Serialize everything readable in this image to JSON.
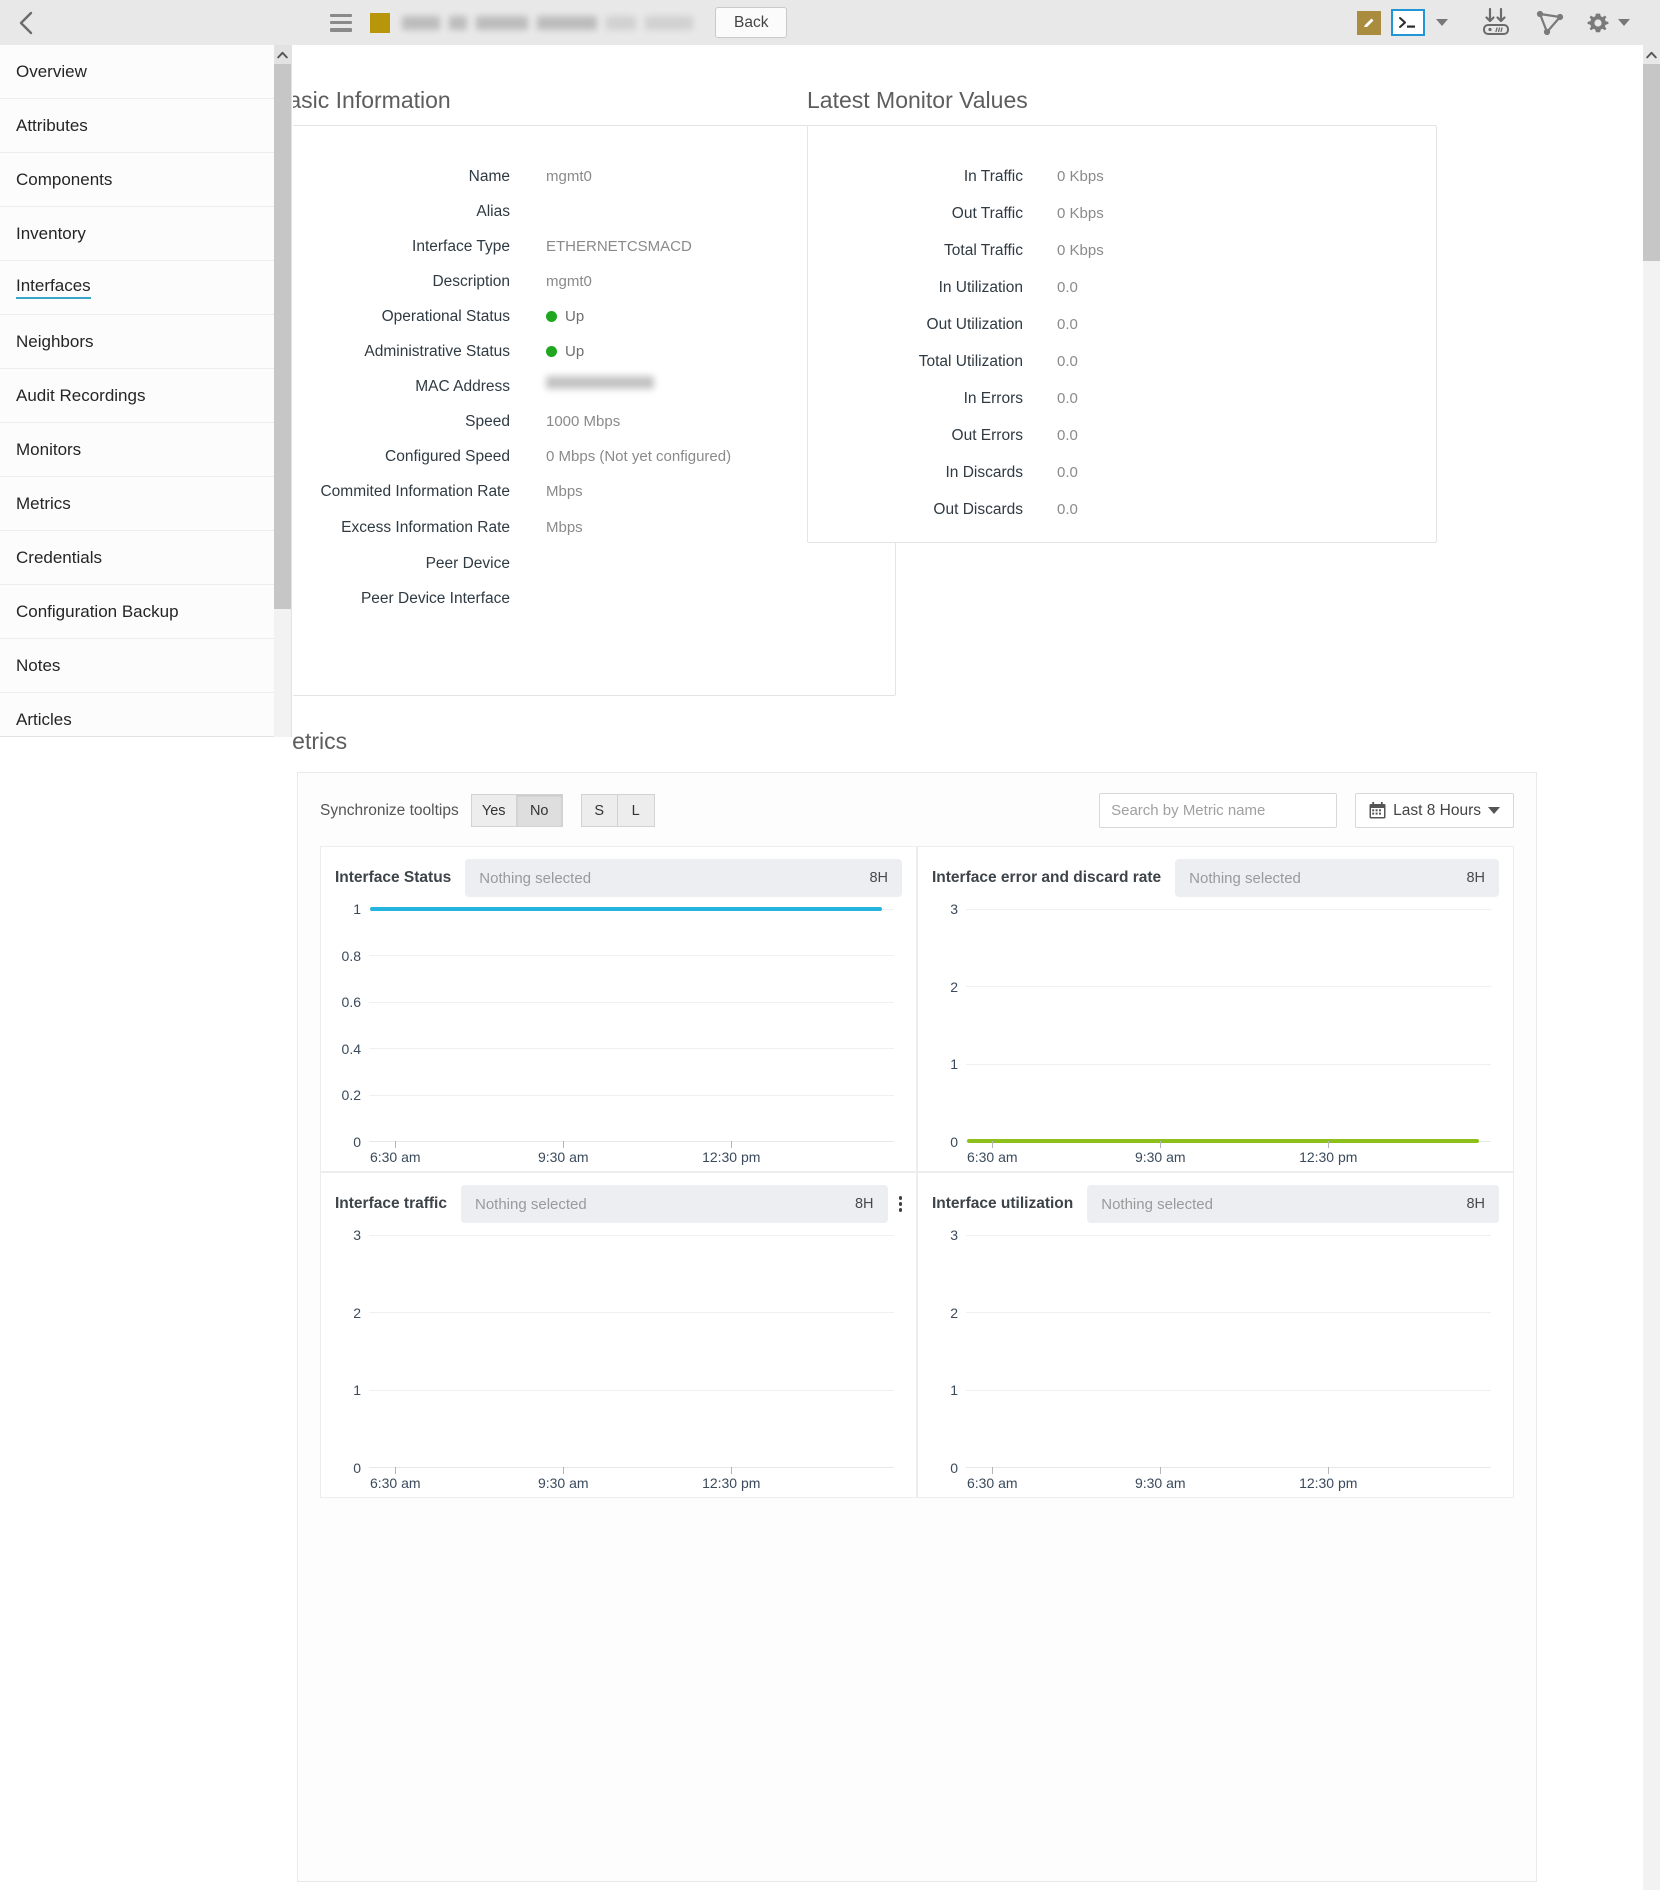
{
  "topbar": {
    "back_chevron_icon": "chevron-left-icon",
    "menu_icon": "hamburger-menu-icon",
    "device_color": "#b8960c",
    "device_name_redacted": true,
    "back_label": "Back",
    "icons": [
      {
        "name": "edit-icon",
        "label": "Edit"
      },
      {
        "name": "terminal-icon",
        "label": "Terminal"
      },
      {
        "name": "terminal-dropdown-caret-icon",
        "label": "Terminal options"
      },
      {
        "name": "download-to-device-icon",
        "label": "Download"
      },
      {
        "name": "topology-icon",
        "label": "Topology"
      },
      {
        "name": "gear-icon",
        "label": "Settings"
      },
      {
        "name": "gear-dropdown-caret-icon",
        "label": "Settings options"
      }
    ]
  },
  "sidebar": {
    "items": [
      {
        "label": "Overview",
        "active": false
      },
      {
        "label": "Attributes",
        "active": false
      },
      {
        "label": "Components",
        "active": false
      },
      {
        "label": "Inventory",
        "active": false
      },
      {
        "label": "Interfaces",
        "active": true
      },
      {
        "label": "Neighbors",
        "active": false
      },
      {
        "label": "Audit Recordings",
        "active": false
      },
      {
        "label": "Monitors",
        "active": false
      },
      {
        "label": "Metrics",
        "active": false
      },
      {
        "label": "Credentials",
        "active": false
      },
      {
        "label": "Configuration Backup",
        "active": false
      },
      {
        "label": "Notes",
        "active": false
      },
      {
        "label": "Articles",
        "active": false
      }
    ]
  },
  "basic_information": {
    "heading": "Basic Information",
    "rows": [
      {
        "label": "Name",
        "value": "mgmt0",
        "type": "text"
      },
      {
        "label": "Alias",
        "value": "",
        "type": "text"
      },
      {
        "label": "Interface Type",
        "value": "ETHERNETCSMACD",
        "type": "text"
      },
      {
        "label": "Description",
        "value": "mgmt0",
        "type": "text"
      },
      {
        "label": "Operational Status",
        "value": "Up",
        "type": "status"
      },
      {
        "label": "Administrative Status",
        "value": "Up",
        "type": "status"
      },
      {
        "label": "MAC Address",
        "value": "",
        "type": "redacted"
      },
      {
        "label": "Speed",
        "value": "1000 Mbps",
        "type": "text"
      },
      {
        "label": "Configured Speed",
        "value": "0 Mbps (Not yet configured)",
        "type": "text"
      },
      {
        "label": "Commited Information Rate",
        "value": "Mbps",
        "type": "text"
      },
      {
        "label": "Excess Information Rate",
        "value": "Mbps",
        "type": "text"
      },
      {
        "label": "Peer Device",
        "value": "",
        "type": "text"
      },
      {
        "label": "Peer Device Interface",
        "value": "",
        "type": "text"
      }
    ],
    "status_color": "#1fa81f"
  },
  "latest_monitor_values": {
    "heading": "Latest Monitor Values",
    "rows": [
      {
        "label": "In Traffic",
        "value": "0 Kbps"
      },
      {
        "label": "Out Traffic",
        "value": "0 Kbps"
      },
      {
        "label": "Total Traffic",
        "value": "0 Kbps"
      },
      {
        "label": "In Utilization",
        "value": "0.0"
      },
      {
        "label": "Out Utilization",
        "value": "0.0"
      },
      {
        "label": "Total Utilization",
        "value": "0.0"
      },
      {
        "label": "In Errors",
        "value": "0.0"
      },
      {
        "label": "Out Errors",
        "value": "0.0"
      },
      {
        "label": "In Discards",
        "value": "0.0"
      },
      {
        "label": "Out Discards",
        "value": "0.0"
      }
    ]
  },
  "metrics": {
    "heading": "Metrics",
    "sync_tooltips_label": "Synchronize tooltips",
    "sync_yes": "Yes",
    "sync_no": "No",
    "sync_selected": "No",
    "size_small": "S",
    "size_large": "L",
    "search_placeholder": "Search by Metric name",
    "search_value": "",
    "calendar_icon": "calendar-icon",
    "range_label": "Last 8 Hours",
    "range_caret_icon": "chevron-down-icon"
  },
  "chart_data": [
    {
      "type": "line",
      "title": "Interface Status",
      "selector_text": "Nothing selected",
      "range_badge": "8H",
      "has_kebab": false,
      "color": "#25b4e0",
      "ylabel": "",
      "xlabel": "",
      "yticks": [
        "0",
        "0.2",
        "0.4",
        "0.6",
        "0.8",
        "1"
      ],
      "ylim": [
        0,
        1
      ],
      "xticks": [
        "6:30 am",
        "9:30 am",
        "12:30 pm"
      ],
      "series": [
        {
          "name": "Interface Status",
          "constant_value": 1
        }
      ],
      "grid": true
    },
    {
      "type": "line",
      "title": "Interface error and discard rate",
      "selector_text": "Nothing selected",
      "range_badge": "8H",
      "has_kebab": false,
      "color": "#8dc01b",
      "ylabel": "",
      "xlabel": "",
      "yticks": [
        "0",
        "1",
        "2",
        "3"
      ],
      "ylim": [
        0,
        3
      ],
      "xticks": [
        "6:30 am",
        "9:30 am",
        "12:30 pm"
      ],
      "series": [
        {
          "name": "Error and discard rate",
          "constant_value": 0
        }
      ],
      "grid": true
    },
    {
      "type": "line",
      "title": "Interface traffic",
      "selector_text": "Nothing selected",
      "range_badge": "8H",
      "has_kebab": true,
      "color": "#25b4e0",
      "ylabel": "",
      "xlabel": "",
      "yticks": [
        "0",
        "1",
        "2",
        "3"
      ],
      "ylim": [
        0,
        3
      ],
      "xticks": [
        "6:30 am",
        "9:30 am",
        "12:30 pm"
      ],
      "series": [],
      "grid": true
    },
    {
      "type": "line",
      "title": "Interface utilization",
      "selector_text": "Nothing selected",
      "range_badge": "8H",
      "has_kebab": false,
      "color": "#25b4e0",
      "ylabel": "",
      "xlabel": "",
      "yticks": [
        "0",
        "1",
        "2",
        "3"
      ],
      "ylim": [
        0,
        3
      ],
      "xticks": [
        "6:30 am",
        "9:30 am",
        "12:30 pm"
      ],
      "series": [],
      "grid": true
    }
  ]
}
